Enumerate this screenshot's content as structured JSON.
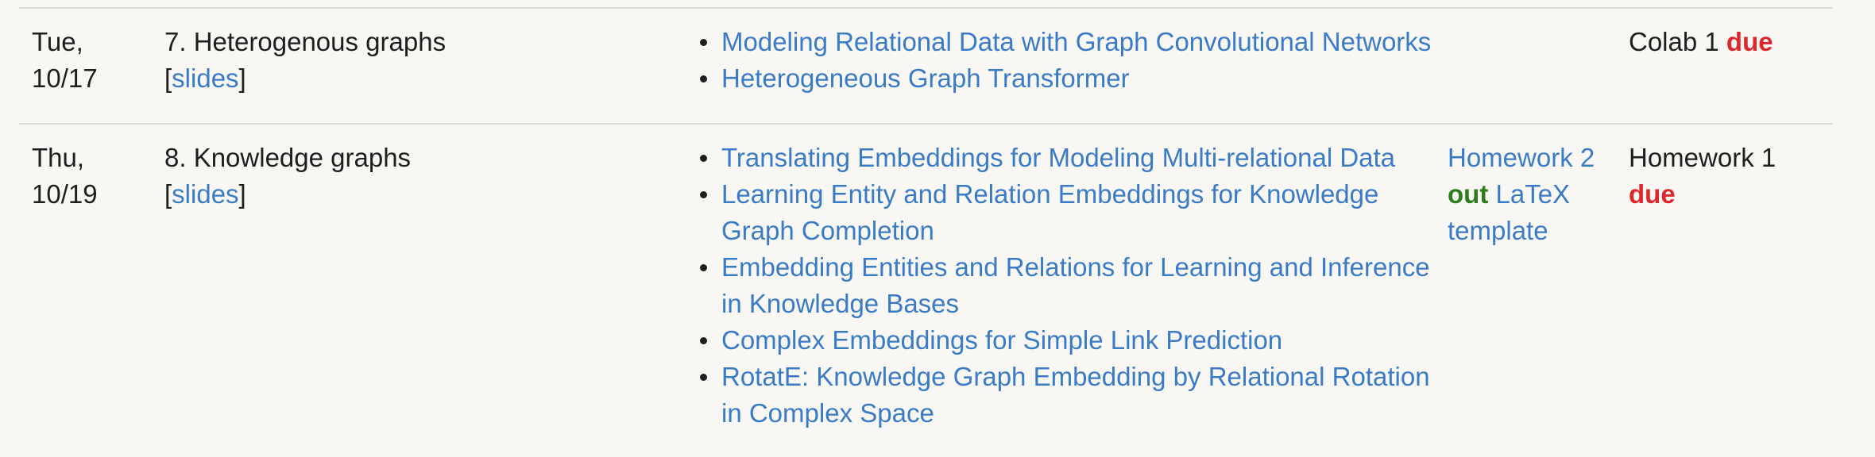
{
  "rows": [
    {
      "date_line1": "Tue,",
      "date_line2": "10/17",
      "topic": "7. Heterogenous graphs",
      "slides_label": "slides",
      "readings": [
        "Modeling Relational Data with Graph Convolutional Networks",
        "Heterogeneous Graph Transformer"
      ],
      "homework": {},
      "due": {
        "text": "Colab 1",
        "due_label": "due"
      }
    },
    {
      "date_line1": "Thu,",
      "date_line2": "10/19",
      "topic": "8. Knowledge graphs",
      "slides_label": "slides",
      "readings": [
        "Translating Embeddings for Modeling Multi-relational Data",
        "Learning Entity and Relation Embeddings for Knowledge Graph Completion",
        "Embedding Entities and Relations for Learning and Inference in Knowledge Bases",
        "Complex Embeddings for Simple Link Prediction",
        "RotatE: Knowledge Graph Embedding by Relational Rotation in Complex Space"
      ],
      "homework": {
        "link_text": "Homework 2",
        "out_label": "out",
        "template_link": "LaTeX template"
      },
      "due": {
        "text": "Homework 1",
        "due_label": "due"
      }
    }
  ],
  "colors": {
    "link": "#3a7bc8",
    "due": "#e0262a",
    "out": "#2e7d1c",
    "text": "#1e1e1e",
    "background": "#f8f7f3"
  }
}
